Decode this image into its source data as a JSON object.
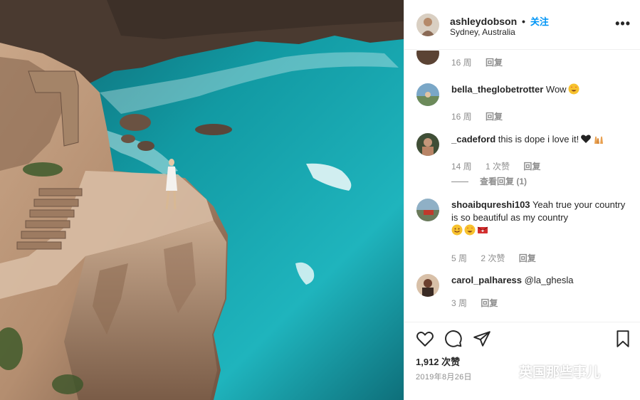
{
  "post": {
    "username": "ashleydobson",
    "separator": "•",
    "follow_label": "关注",
    "location": "Sydney, Australia",
    "more_icon": "more-horizontal-icon"
  },
  "comments": [
    {
      "username": "",
      "text": "",
      "time": "16 周",
      "likes": "",
      "reply": "回复"
    },
    {
      "username": "bella_theglobetrotter",
      "text": "Wow",
      "emojis": [
        "star-struck"
      ],
      "time": "16 周",
      "likes": "",
      "reply": "回复"
    },
    {
      "username": "_cadeford",
      "text": "this is dope i love it!",
      "emojis": [
        "black-heart",
        "raising-hands"
      ],
      "time": "14 周",
      "likes": "1 次赞",
      "reply": "回复",
      "view_replies": "查看回复 (1)"
    },
    {
      "username": "shoaibqureshi103",
      "text": "Yeah true your country is so beautiful as my country",
      "emojis": [
        "smiling-face",
        "star-struck",
        "love-letter"
      ],
      "time": "5 周",
      "likes": "2 次赞",
      "reply": "回复"
    },
    {
      "username": "carol_palharess",
      "text": "@la_ghesla",
      "time": "3 周",
      "likes": "",
      "reply": "回复"
    }
  ],
  "actions": {
    "like_icon": "heart-icon",
    "comment_icon": "comment-icon",
    "share_icon": "paper-plane-icon",
    "save_icon": "bookmark-icon",
    "likes_count": "1,912 次赞",
    "date": "2019年8月26日"
  },
  "watermark": {
    "text": "英国那些事儿"
  },
  "colors": {
    "link": "#0095f6",
    "text": "#262626",
    "muted": "#8e8e8e",
    "water": "#1aa7b0",
    "rock": "#b08a6c"
  }
}
